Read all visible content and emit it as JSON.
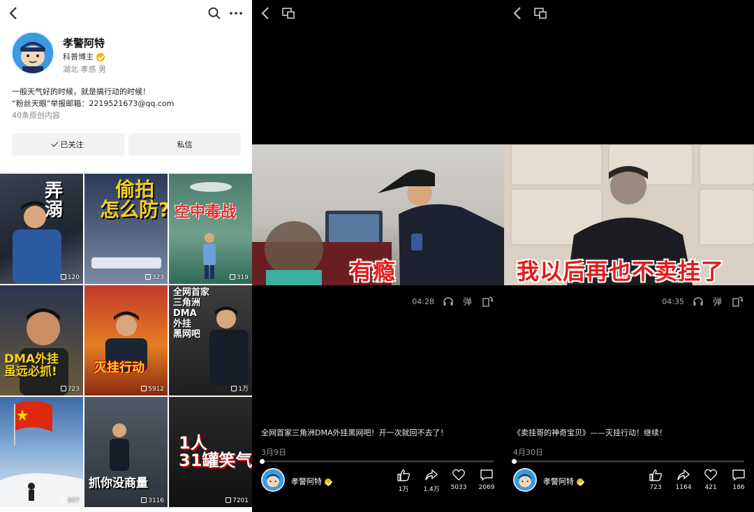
{
  "profile": {
    "name": "孝警阿特",
    "category": "科普博主",
    "location": "湖北 孝感 男",
    "bio_line1": "一般天气好的时候，就是搞行动的时候！",
    "bio_line2": "“粉丝天眼”举报邮箱：2219521673@qq.com",
    "works_count": "40条原创内容",
    "follow_button": "已关注",
    "message_button": "私信"
  },
  "grid": [
    {
      "overlay": "弄\n溺",
      "likes": "120"
    },
    {
      "overlay": "偷拍\n怎么防?",
      "likes": "323"
    },
    {
      "overlay": "空中毒战",
      "likes": "319"
    },
    {
      "overlay": "DMA外挂\n虽远必抓!",
      "likes": "723"
    },
    {
      "overlay": "灭挂行动",
      "likes": "5912"
    },
    {
      "overlay": "全网首家\n三角洲\nDMA\n外挂\n黑网吧",
      "likes": "1万"
    },
    {
      "overlay": "",
      "likes": "607"
    },
    {
      "overlay": "抓你没商量",
      "likes": "3116"
    },
    {
      "overlay": "1人\n31罐笑气",
      "likes": "7201"
    }
  ],
  "videos": [
    {
      "subtitle": "有瘾",
      "duration": "04:28",
      "caption": "全网首家三角洲DMA外挂黑网吧！开一次就回不去了！",
      "date": "3月9日",
      "author": "孝警阿特",
      "likes": "1万",
      "shares": "1.4万",
      "favorites": "5033",
      "comments": "2069"
    },
    {
      "subtitle": "我以后再也不卖挂了",
      "duration": "04:35",
      "caption": "《卖挂哥的神奇宝贝》——灭挂行动！继续！",
      "date": "4月30日",
      "author": "孝警阿特",
      "likes": "723",
      "shares": "1164",
      "favorites": "421",
      "comments": "186"
    }
  ],
  "icons": {
    "back": "back-chevron-icon",
    "search": "search-icon",
    "more": "more-dots-icon",
    "cast": "screen-cast-icon",
    "audio": "headphones-icon",
    "danmaku": "danmaku-icon",
    "rotate": "rotate-screen-icon",
    "like": "thumb-up-icon",
    "share": "share-arrow-icon",
    "favorite": "heart-icon",
    "comment": "comment-icon"
  }
}
